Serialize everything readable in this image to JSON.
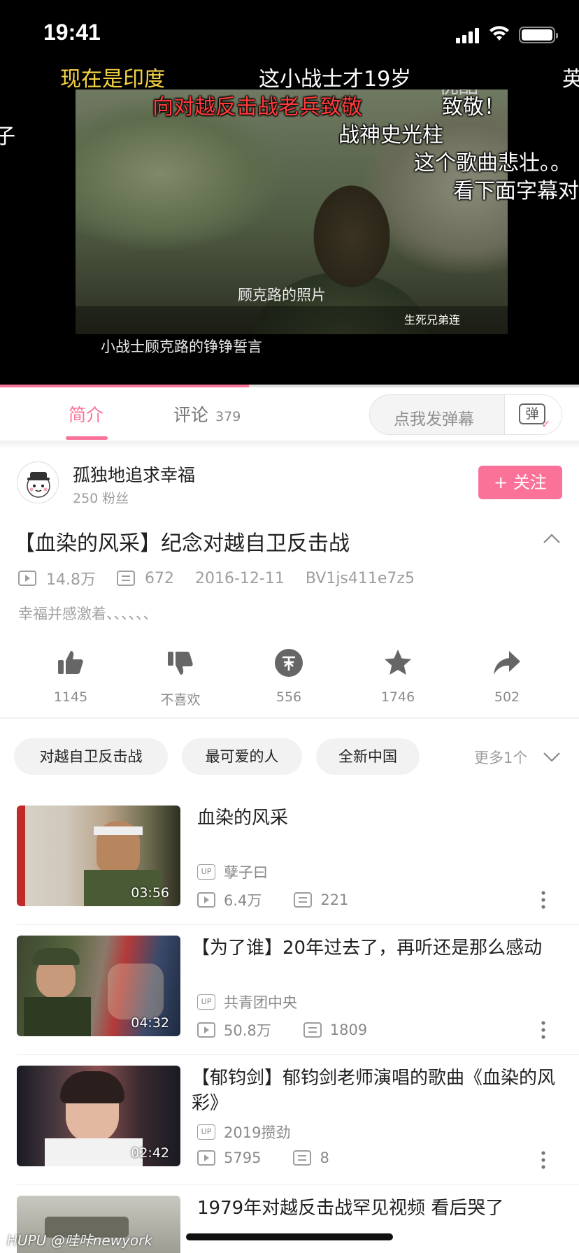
{
  "status": {
    "time": "19:41"
  },
  "video": {
    "burned_caption_1": "顾克路的照片",
    "burned_caption_2": "小战士顾克路的铮铮誓言",
    "logo": "优酷",
    "channel": "生死兄弟连",
    "progress": 0.43,
    "danmaku": [
      {
        "text": "现在是印度",
        "color": "#f5d442"
      },
      {
        "text": "这小战士才19岁",
        "color": "#ffffff"
      },
      {
        "text": "英",
        "color": "#ffffff"
      },
      {
        "text": "向对越反击战老兵致敬",
        "color": "#ff3b3b"
      },
      {
        "text": "致敬！",
        "color": "#ffffff"
      },
      {
        "text": "子",
        "color": "#ffffff"
      },
      {
        "text": "战神史光柱",
        "color": "#ffffff"
      },
      {
        "text": "这个歌曲悲壮。。",
        "color": "#ffffff"
      },
      {
        "text": "看下面字幕对",
        "color": "#ffffff"
      }
    ]
  },
  "tabs": {
    "intro": "简介",
    "comment": "评论",
    "comment_count": "379",
    "danmaku_placeholder": "点我发弹幕",
    "danmaku_toggle": "弹"
  },
  "uploader": {
    "name": "孤独地追求幸福",
    "fans": "250 粉丝",
    "follow": "+ 关注"
  },
  "info": {
    "title": "【血染的风采】纪念对越自卫反击战",
    "views": "14.8万",
    "danmaku_count": "672",
    "date": "2016-12-11",
    "bvid": "BV1js411e7z5",
    "desc": "幸福并感激着、、、、、、"
  },
  "actions": [
    {
      "icon": "thumb-up-icon",
      "label": "1145"
    },
    {
      "icon": "thumb-down-icon",
      "label": "不喜欢"
    },
    {
      "icon": "coin-icon",
      "label": "556"
    },
    {
      "icon": "star-icon",
      "label": "1746"
    },
    {
      "icon": "share-icon",
      "label": "502"
    }
  ],
  "tags": [
    "对越自卫反击战",
    "最可爱的人",
    "全新中国"
  ],
  "more_tags": "更多1个",
  "related": [
    {
      "title": "血染的风采",
      "duration": "03:56",
      "up": "孽子曰",
      "views": "6.4万",
      "danmaku": "221"
    },
    {
      "title": "【为了谁】20年过去了，再听还是那么感动",
      "duration": "04:32",
      "up": "共青团中央",
      "views": "50.8万",
      "danmaku": "1809"
    },
    {
      "title": "【郁钧剑】郁钧剑老师演唱的歌曲《血染的风彩》",
      "duration": "02:42",
      "up": "2019攒劲",
      "views": "5795",
      "danmaku": "8"
    },
    {
      "title": "1979年对越反击战罕见视频  看后哭了",
      "duration": "",
      "up": "",
      "views": "",
      "danmaku": ""
    }
  ],
  "watermark": "HUPU @哇咔newyork"
}
